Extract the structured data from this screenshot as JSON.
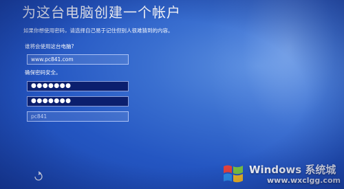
{
  "page": {
    "title": "为这台电脑创建一个帐户",
    "subtitle": "如果你想使用密码，请选择自己易于记住但别人很难猜到的内容。"
  },
  "form": {
    "user_label": "谁将会使用这台电脑?",
    "username_value": "www.pc841.com",
    "password_label": "确保密码安全。",
    "password_value": "●●●●●●●",
    "password_confirm_value": "●●●●●●●",
    "hint_value": "pc841"
  },
  "watermark": {
    "brand": "Windows 系统城",
    "url": "www.wxclgg.com",
    "logo_icon": "windows-logo-icon",
    "colors": {
      "red": "#e8433a",
      "green": "#7cc43e",
      "blue": "#2b8fe6",
      "yellow": "#f5b91d"
    }
  },
  "nav": {
    "back_icon": "back-arrow-icon"
  }
}
